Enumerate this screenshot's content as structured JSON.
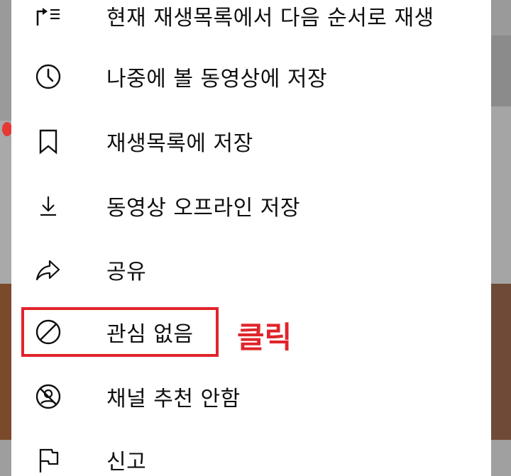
{
  "menu": {
    "items": [
      {
        "icon": "play-next-icon",
        "label": "현재 재생목록에서 다음 순서로 재생"
      },
      {
        "icon": "clock-icon",
        "label": "나중에 볼 동영상에 저장"
      },
      {
        "icon": "bookmark-icon",
        "label": "재생목록에 저장"
      },
      {
        "icon": "download-icon",
        "label": "동영상 오프라인 저장"
      },
      {
        "icon": "share-icon",
        "label": "공유"
      },
      {
        "icon": "not-interested-icon",
        "label": "관심 없음"
      },
      {
        "icon": "dont-recommend-channel-icon",
        "label": "채널 추천 안함"
      },
      {
        "icon": "flag-icon",
        "label": "신고"
      }
    ]
  },
  "annotation": {
    "text": "클릭",
    "color": "#e0242b"
  }
}
